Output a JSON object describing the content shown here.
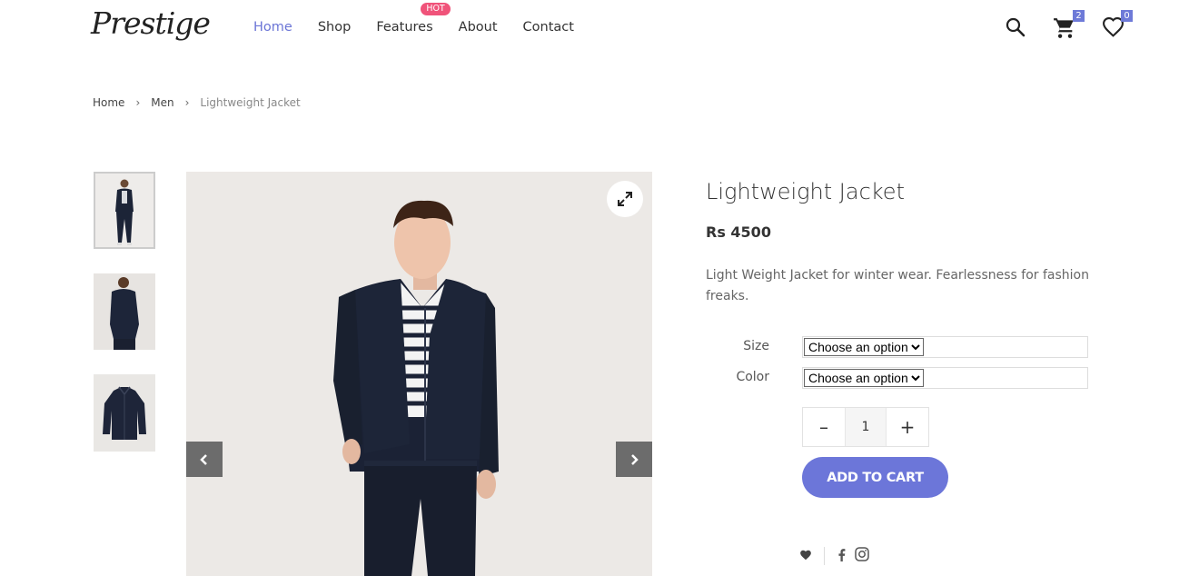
{
  "header": {
    "logo": "Prestige",
    "nav": [
      {
        "label": "Home",
        "active": true
      },
      {
        "label": "Shop"
      },
      {
        "label": "Features",
        "badge": "HOT"
      },
      {
        "label": "About"
      },
      {
        "label": "Contact"
      }
    ],
    "cart_count": "2",
    "wishlist_count": "0",
    "icons": [
      "search-icon",
      "cart-icon",
      "heart-icon"
    ]
  },
  "breadcrumb": [
    {
      "label": "Home"
    },
    {
      "label": "Men"
    },
    {
      "label": "Lightweight Jacket"
    }
  ],
  "product": {
    "title": "Lightweight Jacket",
    "price": "Rs 4500",
    "description": "Light Weight Jacket for winter wear. Fearlessness for fashion freaks.",
    "options": [
      {
        "label": "Size",
        "selected": "Choose an option"
      },
      {
        "label": "Color",
        "selected": "Choose an option"
      }
    ],
    "quantity": "1",
    "qty_minus": "–",
    "qty_plus": "+",
    "add_to_cart": "ADD TO CART",
    "thumbnail_count": 3,
    "selected_thumbnail": 1
  },
  "colors": {
    "accent": "#6c76d9",
    "hot_badge": "#f0537a",
    "count_badge": "#6e7ad8"
  }
}
